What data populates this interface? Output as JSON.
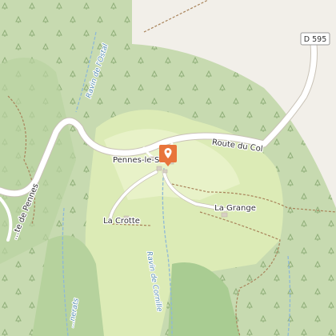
{
  "map": {
    "colors": {
      "forest": "#c7dab0",
      "forest_dark": "#a9cc92",
      "meadow": "#dcebb6",
      "light_green": "#e8f2c8",
      "bare": "#f2efe9",
      "road": "#ffffff",
      "stream": "#8fb9d6",
      "marker": "#e8743b"
    },
    "road_shield": "D 595",
    "roads": [
      {
        "name": "Route du Col"
      },
      {
        "name": "...te de Pennes"
      }
    ],
    "places": [
      {
        "name": "Pennes-le-Sec"
      },
      {
        "name": "La Crotte"
      },
      {
        "name": "La Grange"
      }
    ],
    "streams": [
      {
        "name": "Ravin de l'Ostal"
      },
      {
        "name": "Ravin de Cornille"
      },
      {
        "name": "...nerats"
      }
    ],
    "marker": {
      "icon": "map-pin-icon"
    }
  }
}
